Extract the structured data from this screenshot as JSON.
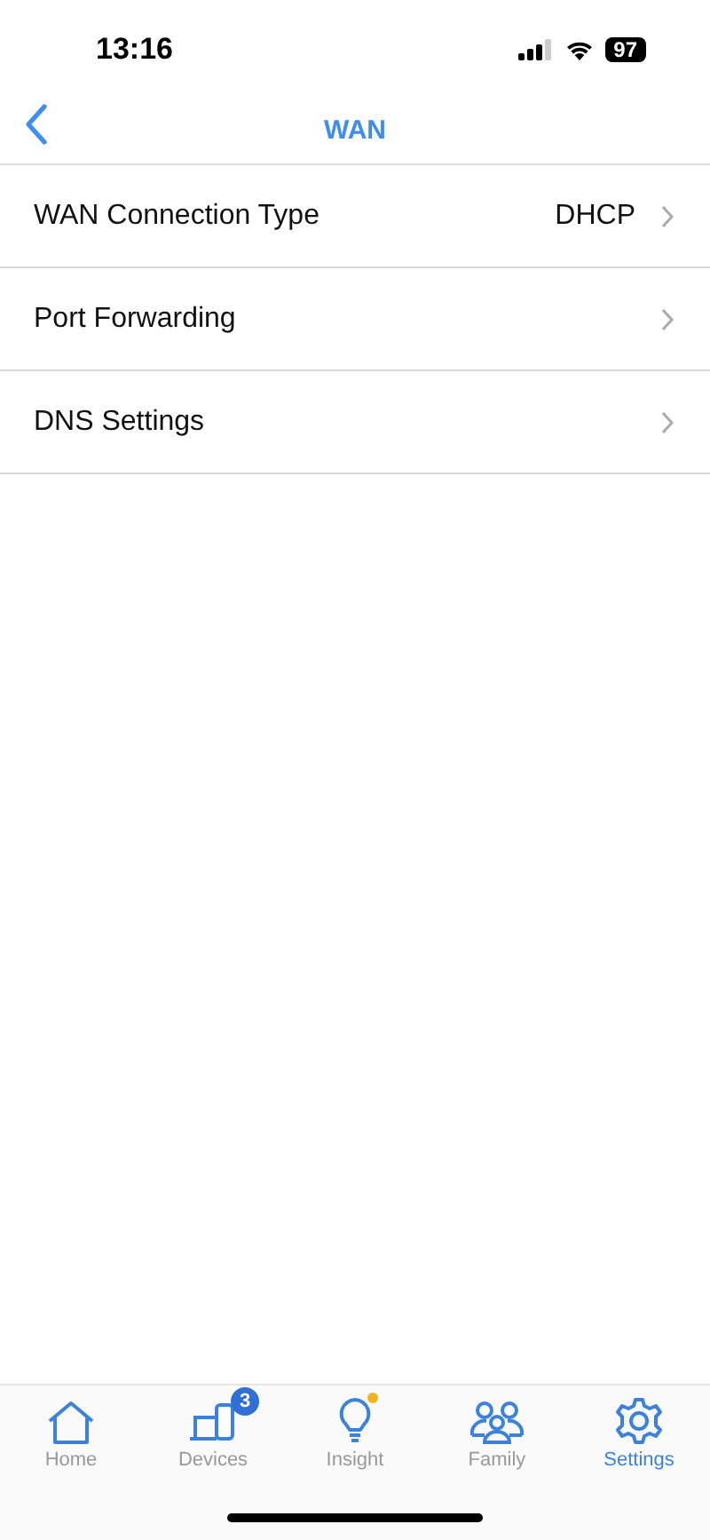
{
  "status_bar": {
    "time": "13:16",
    "battery": "97"
  },
  "nav": {
    "title": "WAN"
  },
  "rows": [
    {
      "label": "WAN Connection Type",
      "value": "DHCP"
    },
    {
      "label": "Port Forwarding"
    },
    {
      "label": "DNS Settings"
    }
  ],
  "tabs": [
    {
      "kind": "home",
      "label": "Home",
      "selected": false,
      "dot": false
    },
    {
      "kind": "devices",
      "label": "Devices",
      "selected": false,
      "badge": "3",
      "dot": false
    },
    {
      "kind": "insight",
      "label": "Insight",
      "selected": false,
      "dot": true
    },
    {
      "kind": "family",
      "label": "Family",
      "selected": false,
      "dot": false
    },
    {
      "kind": "settings",
      "label": "Settings",
      "selected": true,
      "dot": false
    }
  ]
}
